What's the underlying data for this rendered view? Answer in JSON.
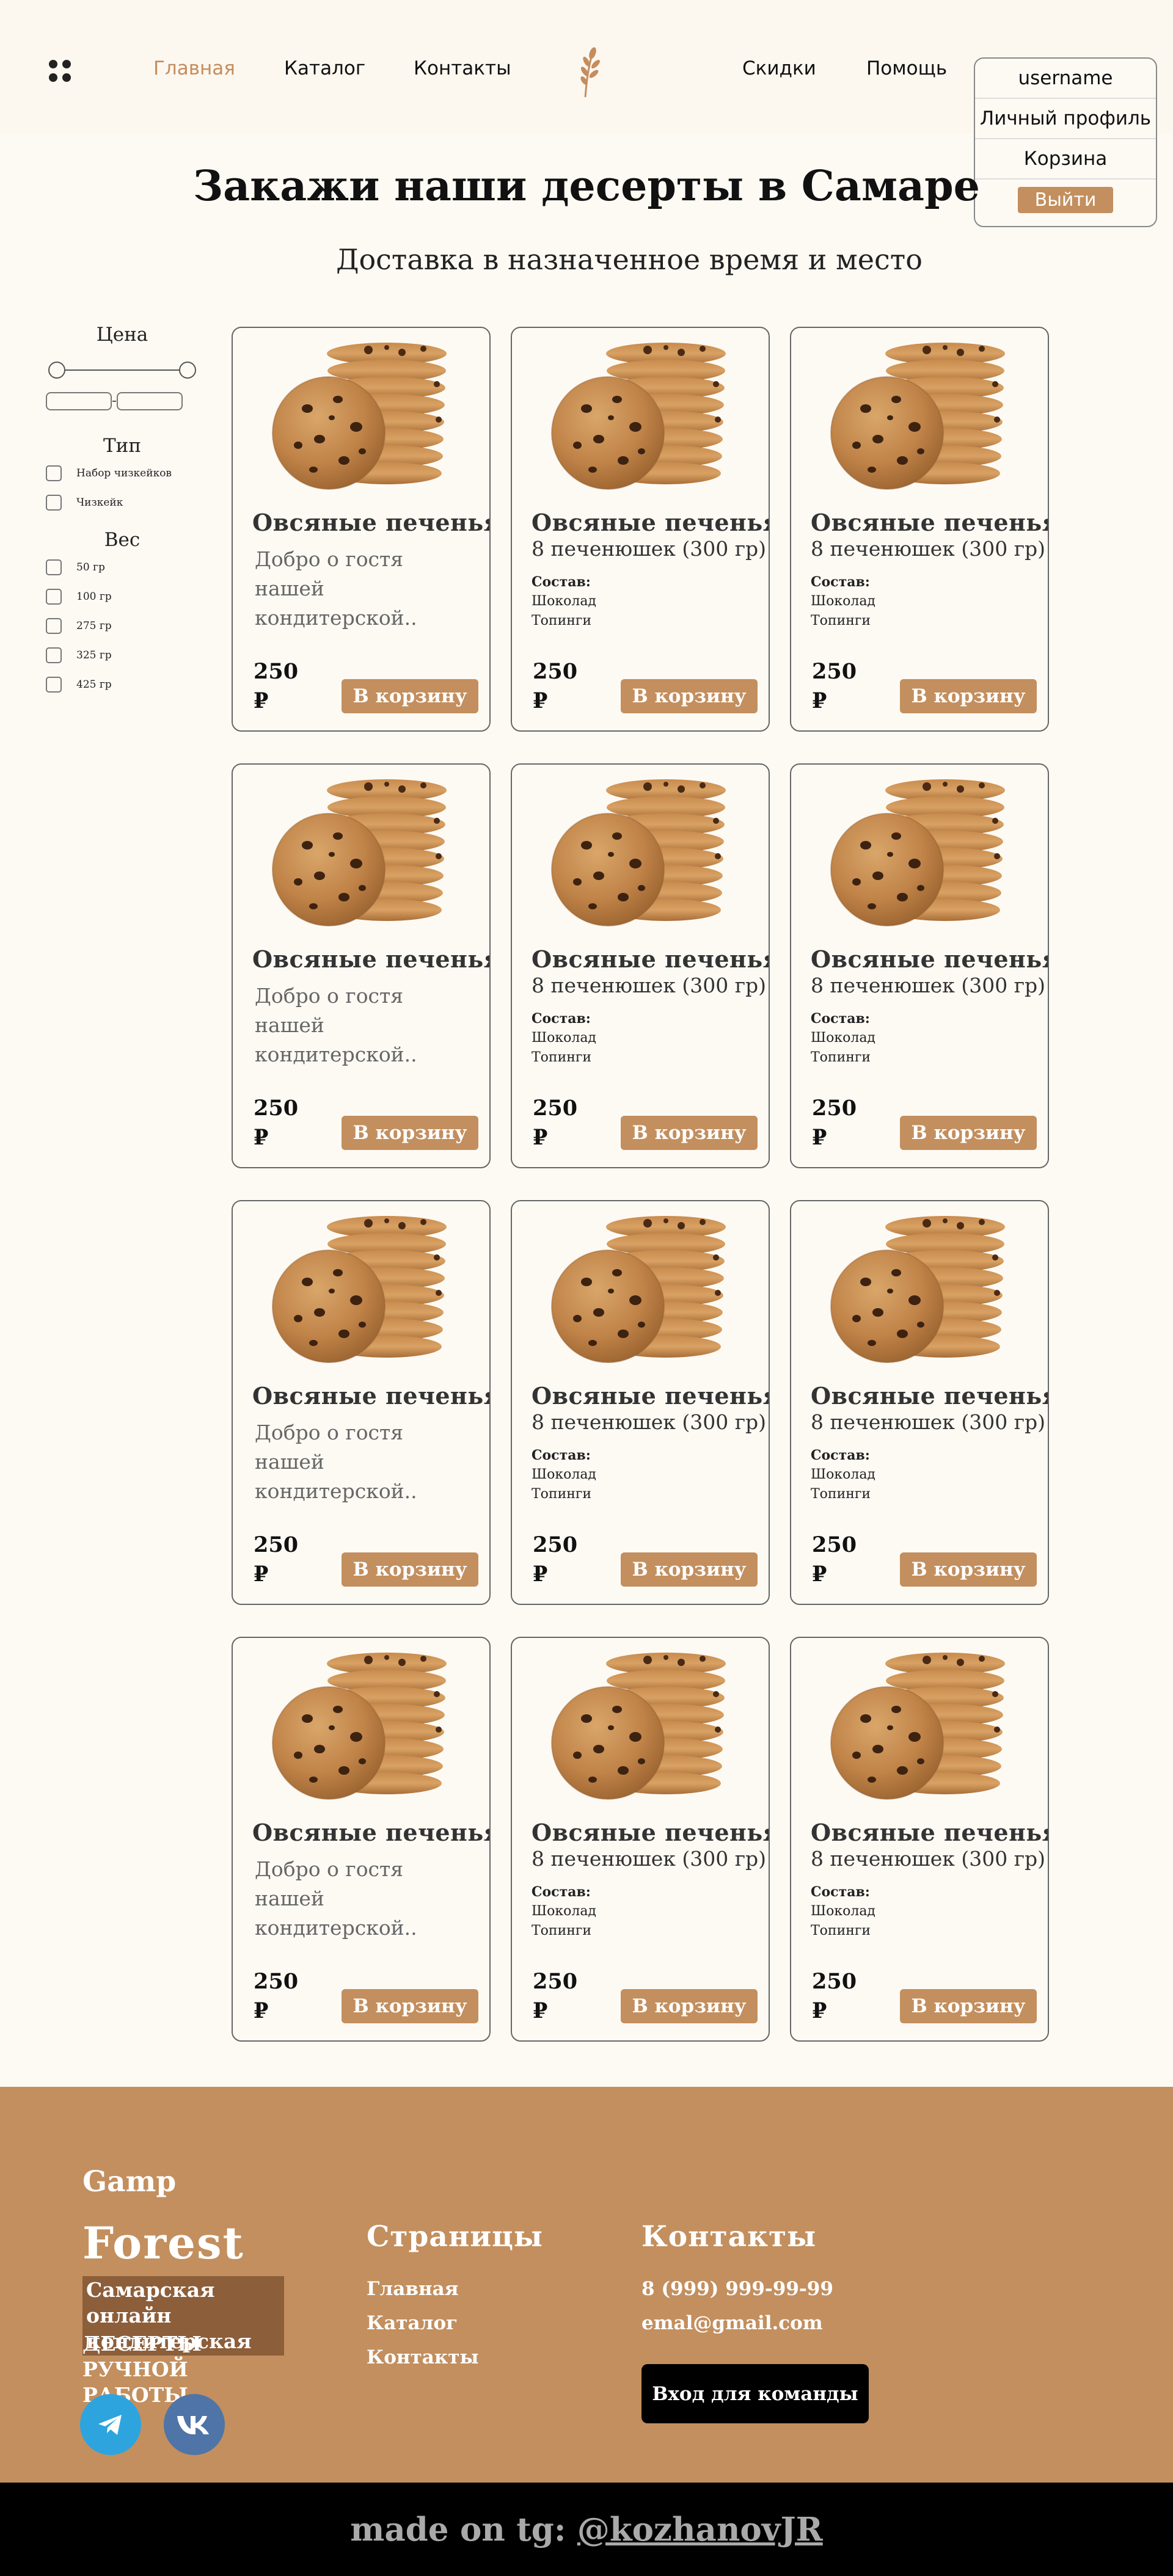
{
  "header": {
    "nav_left": [
      "Главная",
      "Каталог",
      "Контакты"
    ],
    "nav_right": [
      "Скидки",
      "Помощь"
    ]
  },
  "user_menu": {
    "username": "username",
    "profile": "Личный профиль",
    "cart": "Корзина",
    "logout": "Выйти"
  },
  "main": {
    "title": "Закажи наши десерты в Самаре",
    "subtitle": "Доставка в назначенное время и место"
  },
  "filters": {
    "price_heading": "Цена",
    "type_heading": "Тип",
    "type_options": [
      "Набор чизкейков",
      "Чизкейк"
    ],
    "weight_heading": "Вес",
    "weight_options": [
      "50 гр",
      "100 гр",
      "275 гр",
      "325 гр",
      "425 гр"
    ]
  },
  "card_a": {
    "title": "Овсяные печенья",
    "description": "Добро о гостя нашей кондитерской..",
    "price": "250",
    "currency": "₽",
    "button": "В корзину"
  },
  "card_b": {
    "title": "Овсяные печенья",
    "subtitle": "8 печенюшек (300 гр)",
    "composition_label": "Состав:",
    "composition": [
      "Шоколад",
      "Топинги"
    ],
    "price": "250",
    "currency": "₽",
    "button": "В корзину"
  },
  "footer": {
    "brand_top": "Gamp",
    "brand_bottom": "Forest",
    "tagline": "Самарская онлайн кондитерская",
    "tagline2": "ДЕСЕРТЫ РУЧНОЙ РАБОТЫ",
    "pages_title": "Страницы",
    "pages": [
      "Главная",
      "Каталог",
      "Контакты"
    ],
    "contacts_title": "Контакты",
    "phone": "8 (999) 999-99-99",
    "email": "emal@gmail.com",
    "team_button": "Вход для команды"
  },
  "credit": {
    "prefix": "made on tg: ",
    "handle": "@kozhanovJR"
  },
  "colors": {
    "accent": "#c38f5e",
    "nav_active": "#c58d5e",
    "footer_bg": "#c38f5e",
    "bottom_bar": "#000000",
    "page_bg": "#fdfaf4"
  },
  "icons": [
    "menu-dots-icon",
    "wheat-logo-icon",
    "cookie-image",
    "telegram-icon",
    "vk-icon"
  ]
}
